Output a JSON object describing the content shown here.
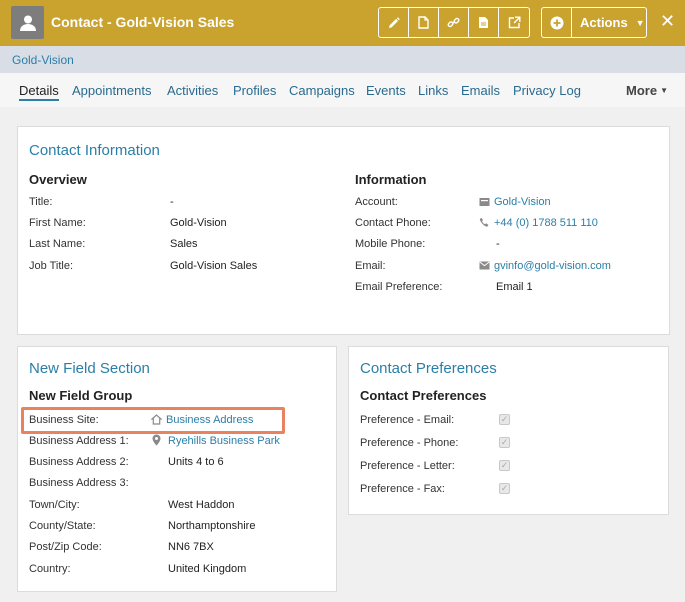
{
  "header": {
    "title": "Contact - Gold-Vision Sales",
    "actions_label": "Actions",
    "toolbar_icons": [
      "pencil-icon",
      "document-icon",
      "link-icon",
      "file-icon",
      "external-link-icon"
    ],
    "accent_color": "#c9a32d"
  },
  "breadcrumb": "Gold-Vision",
  "tabs": [
    "Details",
    "Appointments",
    "Activities",
    "Profiles",
    "Campaigns",
    "Events",
    "Links",
    "Emails",
    "Privacy Log"
  ],
  "more_label": "More",
  "contact_info": {
    "title": "Contact Information",
    "overview": {
      "heading": "Overview",
      "rows": [
        {
          "label": "Title:",
          "value": "-"
        },
        {
          "label": "First Name:",
          "value": "Gold-Vision"
        },
        {
          "label": "Last Name:",
          "value": "Sales"
        },
        {
          "label": "Job Title:",
          "value": "Gold-Vision Sales"
        }
      ]
    },
    "information": {
      "heading": "Information",
      "rows": [
        {
          "label": "Account:",
          "value": "Gold-Vision"
        },
        {
          "label": "Contact Phone:",
          "value": "+44 (0) 1788 511 110"
        },
        {
          "label": "Mobile Phone:",
          "value": "-"
        },
        {
          "label": "Email:",
          "value": "gvinfo@gold-vision.com"
        },
        {
          "label": "Email Preference:",
          "value": "Email 1"
        }
      ]
    }
  },
  "new_field": {
    "title": "New Field Section",
    "group": "New Field Group",
    "rows": [
      {
        "label": "Business Site:",
        "value": "Business Address"
      },
      {
        "label": "Business Address 1:",
        "value": "Ryehills Business Park"
      },
      {
        "label": "Business Address 2:",
        "value": "Units 4 to 6"
      },
      {
        "label": "Business Address 3:",
        "value": ""
      },
      {
        "label": "Town/City:",
        "value": "West Haddon"
      },
      {
        "label": "County/State:",
        "value": "Northamptonshire"
      },
      {
        "label": "Post/Zip Code:",
        "value": "NN6 7BX"
      },
      {
        "label": "Country:",
        "value": "United Kingdom"
      }
    ]
  },
  "preferences": {
    "title": "Contact Preferences",
    "group": "Contact Preferences",
    "rows": [
      {
        "label": "Preference - Email:",
        "checked": true
      },
      {
        "label": "Preference - Phone:",
        "checked": true
      },
      {
        "label": "Preference - Letter:",
        "checked": true
      },
      {
        "label": "Preference - Fax:",
        "checked": true
      }
    ]
  }
}
